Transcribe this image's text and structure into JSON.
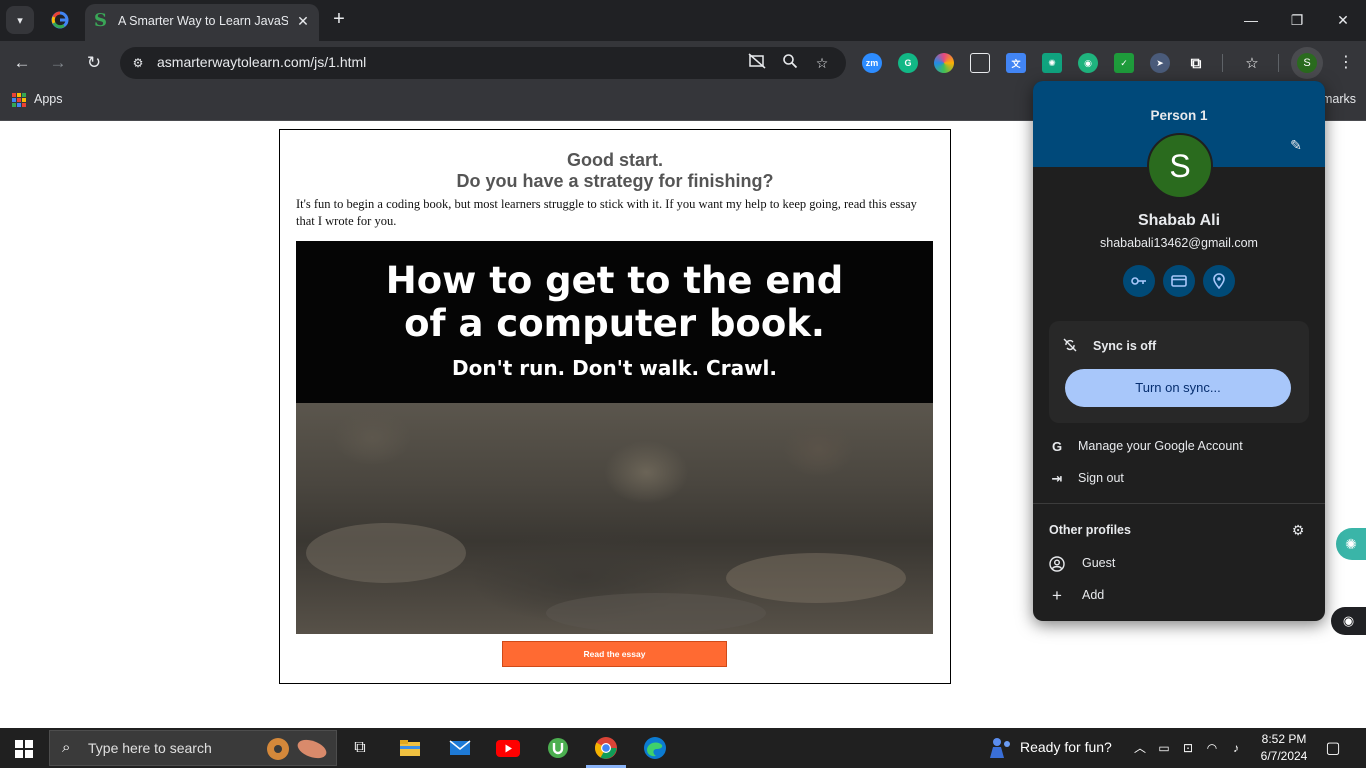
{
  "browser": {
    "tab_title": "A Smarter Way to Learn JavaScr",
    "tab_close": "✕",
    "new_tab": "+",
    "url": "asmarterwaytolearn.com/js/1.html",
    "bookmarks_apps": "Apps",
    "bookmarks_right": "marks",
    "window_controls": [
      "—",
      "❐",
      "✕"
    ]
  },
  "page": {
    "heading_line1": "Good start.",
    "heading_line2": "Do you have a strategy for finishing?",
    "intro": "It's fun to begin a coding book, but most learners struggle to stick with it. If you want my help to keep going, read this essay that I wrote for you.",
    "banner_title_line1": "How to get to the end",
    "banner_title_line2": "of a computer book.",
    "banner_subtitle": "Don't run. Don't walk. Crawl.",
    "button_label": "Read the essay",
    "button_color": "#ff6a32"
  },
  "profile_menu": {
    "profile_label": "Person 1",
    "avatar_letter": "S",
    "full_name": "Shabab Ali",
    "email": "shababali13462@gmail.com",
    "quick_actions": [
      "key-icon",
      "card-icon",
      "location-icon"
    ],
    "sync_status": "Sync is off",
    "sync_button": "Turn on sync...",
    "manage_account": "Manage your Google Account",
    "sign_out": "Sign out",
    "other_profiles": "Other profiles",
    "guest": "Guest",
    "add": "Add",
    "header_color": "#00497a",
    "avatar_color": "#2a6b1e"
  },
  "taskbar": {
    "search_placeholder": "Type here to search",
    "weather_text": "Ready for fun?",
    "time": "8:52 PM",
    "date": "6/7/2024"
  }
}
